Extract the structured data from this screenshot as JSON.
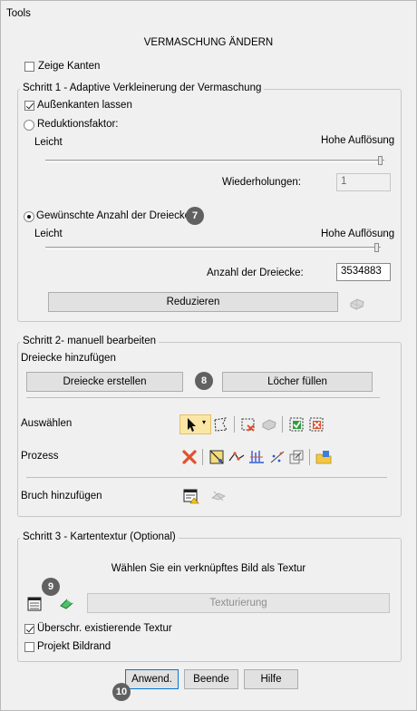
{
  "window": {
    "title": "Tools"
  },
  "header": {
    "heading": "VERMASCHUNG ÄNDERN"
  },
  "show_edges": {
    "label": "Zeige Kanten",
    "checked": false
  },
  "step1": {
    "legend": "Schritt 1 - Adaptive  Verkleinerung der Vermaschung",
    "keep_outer_edges": {
      "label": "Außenkanten lassen",
      "checked": true
    },
    "reduction_factor": {
      "label": "Reduktionsfaktor:",
      "selected": false
    },
    "slider1": {
      "left_label": "Leicht",
      "right_label": "Hohe Auflösung",
      "value_fraction": 1.0
    },
    "repetitions": {
      "label": "Wiederholungen:",
      "value": "1"
    },
    "desired_triangles": {
      "label": "Gewünschte Anzahl der Dreiecke",
      "selected": true
    },
    "slider2": {
      "left_label": "Leicht",
      "right_label": "Hohe Auflösung",
      "value_fraction": 1.0
    },
    "triangle_count": {
      "label": "Anzahl der Dreiecke:",
      "value": "3534883"
    },
    "reduce_button": "Reduzieren"
  },
  "step2": {
    "legend": "Schritt 2- manuell bearbeiten",
    "add_triangles_label": "Dreiecke hinzufügen",
    "create_triangles_button": "Dreiecke erstellen",
    "fill_holes_button": "Löcher füllen",
    "select_label": "Auswählen",
    "process_label": "Prozess",
    "add_break_label": "Bruch hinzufügen"
  },
  "step3": {
    "legend": "Schritt 3 - Kartentextur (Optional)",
    "prompt": "Wählen Sie ein verknüpftes Bild als Textur",
    "texturing_button": "Texturierung",
    "overwrite_texture": {
      "label": "Überschr. existierende Textur",
      "checked": true
    },
    "project_border": {
      "label": "Projekt Bildrand",
      "checked": false
    }
  },
  "footer": {
    "apply_button": "Anwend.",
    "finish_button": "Beende",
    "help_button": "Hilfe"
  },
  "badges": {
    "b7": "7",
    "b8": "8",
    "b9": "9",
    "b10": "10"
  },
  "colors": {
    "background": "#f0f0f0",
    "badge": "#616161",
    "focus": "#0078d7",
    "delete_red": "#e0522e",
    "confirm_green": "#2e9e3e"
  }
}
